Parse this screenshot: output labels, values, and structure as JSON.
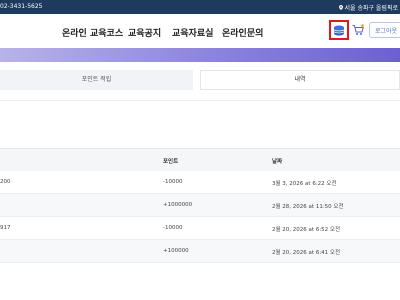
{
  "topbar": {
    "phone": "02-3431-5625",
    "location": "서울 송파구 올림픽로"
  },
  "nav": {
    "menu": [
      "온라인 교육코스",
      "교육공지",
      "교육자료실",
      "온라인문의"
    ],
    "login_label": "로그아웃"
  },
  "tabs": {
    "left": "포인트 적립",
    "right": "내역"
  },
  "table": {
    "headers": {
      "points": "포인트",
      "date": "날짜"
    },
    "rows": [
      {
        "id": "200",
        "points": "-10000",
        "date": "3월 3, 2026 at 6:22 오전"
      },
      {
        "id": "",
        "points": "+1000000",
        "date": "2월 28, 2026 at 11:50 오전"
      },
      {
        "id": "917",
        "points": "-10000",
        "date": "2월 20, 2026 at 6:52 오전"
      },
      {
        "id": "",
        "points": "+100000",
        "date": "2월 20, 2026 at 6:41 오전"
      }
    ]
  },
  "colors": {
    "topbar": "#1f3a5f",
    "accent": "#4a6fb5",
    "highlight_border": "#e01919"
  },
  "icons": {
    "location": "map-pin-icon",
    "points": "coin-stack-icon",
    "cart": "cart-icon"
  }
}
